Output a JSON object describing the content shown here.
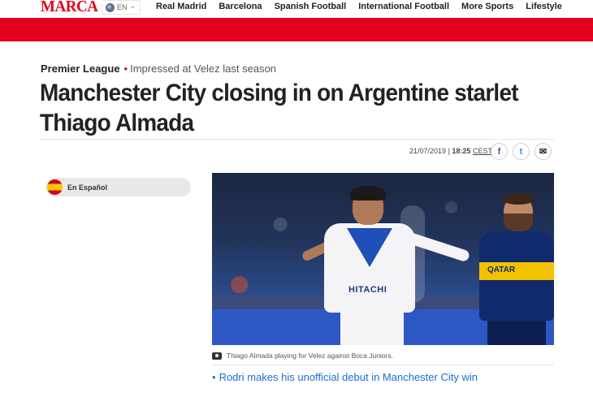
{
  "header": {
    "logo": "MARCA",
    "language": "EN",
    "language_chevron": "⌄",
    "nav": [
      "Real Madrid",
      "Barcelona",
      "Spanish Football",
      "International Football",
      "More Sports",
      "Lifestyle"
    ]
  },
  "colors": {
    "brand_red": "#e2001a",
    "link_blue": "#1a6fd0"
  },
  "article": {
    "category": "Premier League",
    "bullet": "•",
    "subtitle": "Impressed at Velez last season",
    "headline": "Manchester City closing in on Argentine starlet Thiago Almada",
    "date": "21/07/2019",
    "separator": "|",
    "time": "18:25",
    "timezone": "CEST",
    "share": {
      "facebook_glyph": "f",
      "twitter_glyph": "t",
      "email_glyph": "✉"
    },
    "spanish_link": "En Español",
    "photo": {
      "sponsor_left": "HITACHI",
      "sponsor_right": "QATAR"
    },
    "caption": "Thiago Almada playing for Velez against Boca Juniors.",
    "related_bullet": "•",
    "related": "Rodri makes his unofficial debut in Manchester City win"
  },
  "icons": {
    "globe": "globe-icon",
    "camera": "camera-icon",
    "flag": "spain-flag-icon",
    "facebook": "facebook-icon",
    "twitter": "twitter-icon",
    "email": "email-icon"
  }
}
